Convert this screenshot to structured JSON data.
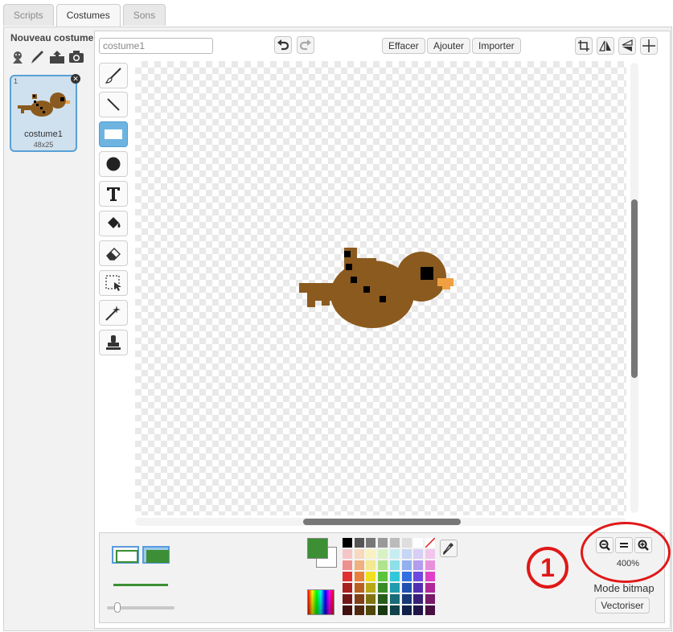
{
  "tabs": [
    {
      "label": "Scripts",
      "active": false
    },
    {
      "label": "Costumes",
      "active": true
    },
    {
      "label": "Sons",
      "active": false
    }
  ],
  "new_costume": {
    "title": "Nouveau costume:",
    "icons": [
      "sprite-library-icon",
      "paint-brush-icon",
      "upload-icon",
      "camera-icon"
    ]
  },
  "costume": {
    "number": "1",
    "name": "costume1",
    "size": "48x25"
  },
  "editor": {
    "name_value": "costume1",
    "clear_label": "Effacer",
    "add_label": "Ajouter",
    "import_label": "Importer"
  },
  "tools": [
    "brush",
    "line",
    "rectangle",
    "ellipse",
    "text",
    "fill",
    "eraser",
    "select",
    "magic-select",
    "stamp"
  ],
  "zoom": {
    "percent": "400%"
  },
  "mode": {
    "label": "Mode bitmap",
    "convert_label": "Vectoriser"
  },
  "annotation": {
    "number": "1"
  },
  "colors": {
    "fill": "#3c8f34",
    "accent": "#58a1d6",
    "annotation": "#e01818",
    "bird_body": "#8b5a1e",
    "bird_beak": "#f0a040"
  },
  "palette": [
    [
      "#000000",
      "#555555",
      "#777777",
      "#999999",
      "#bbbbbb",
      "#dddddd",
      "#ffffff",
      "transparent"
    ],
    [
      "#f6c6c6",
      "#f7d9bd",
      "#f8f2c2",
      "#d8f2c4",
      "#c6eef2",
      "#c6d6f6",
      "#d8cef6",
      "#f2c6ec"
    ],
    [
      "#ee9090",
      "#f0b080",
      "#f4e890",
      "#b0e48c",
      "#8ee0e8",
      "#90b0ee",
      "#b49cee",
      "#e890dc"
    ],
    [
      "#e03030",
      "#e8803a",
      "#f0e020",
      "#5cc43a",
      "#30c8d8",
      "#3070e0",
      "#7048e0",
      "#e040c8"
    ],
    [
      "#a82020",
      "#b86020",
      "#b8a818",
      "#3a8c28",
      "#209cac",
      "#2050b0",
      "#5030b0",
      "#b02898"
    ],
    [
      "#701818",
      "#804018",
      "#807410",
      "#285c1c",
      "#186c78",
      "#183878",
      "#382078",
      "#781c68"
    ],
    [
      "#401010",
      "#502810",
      "#504808",
      "#183812",
      "#104048",
      "#102048",
      "#201448",
      "#481040"
    ]
  ]
}
